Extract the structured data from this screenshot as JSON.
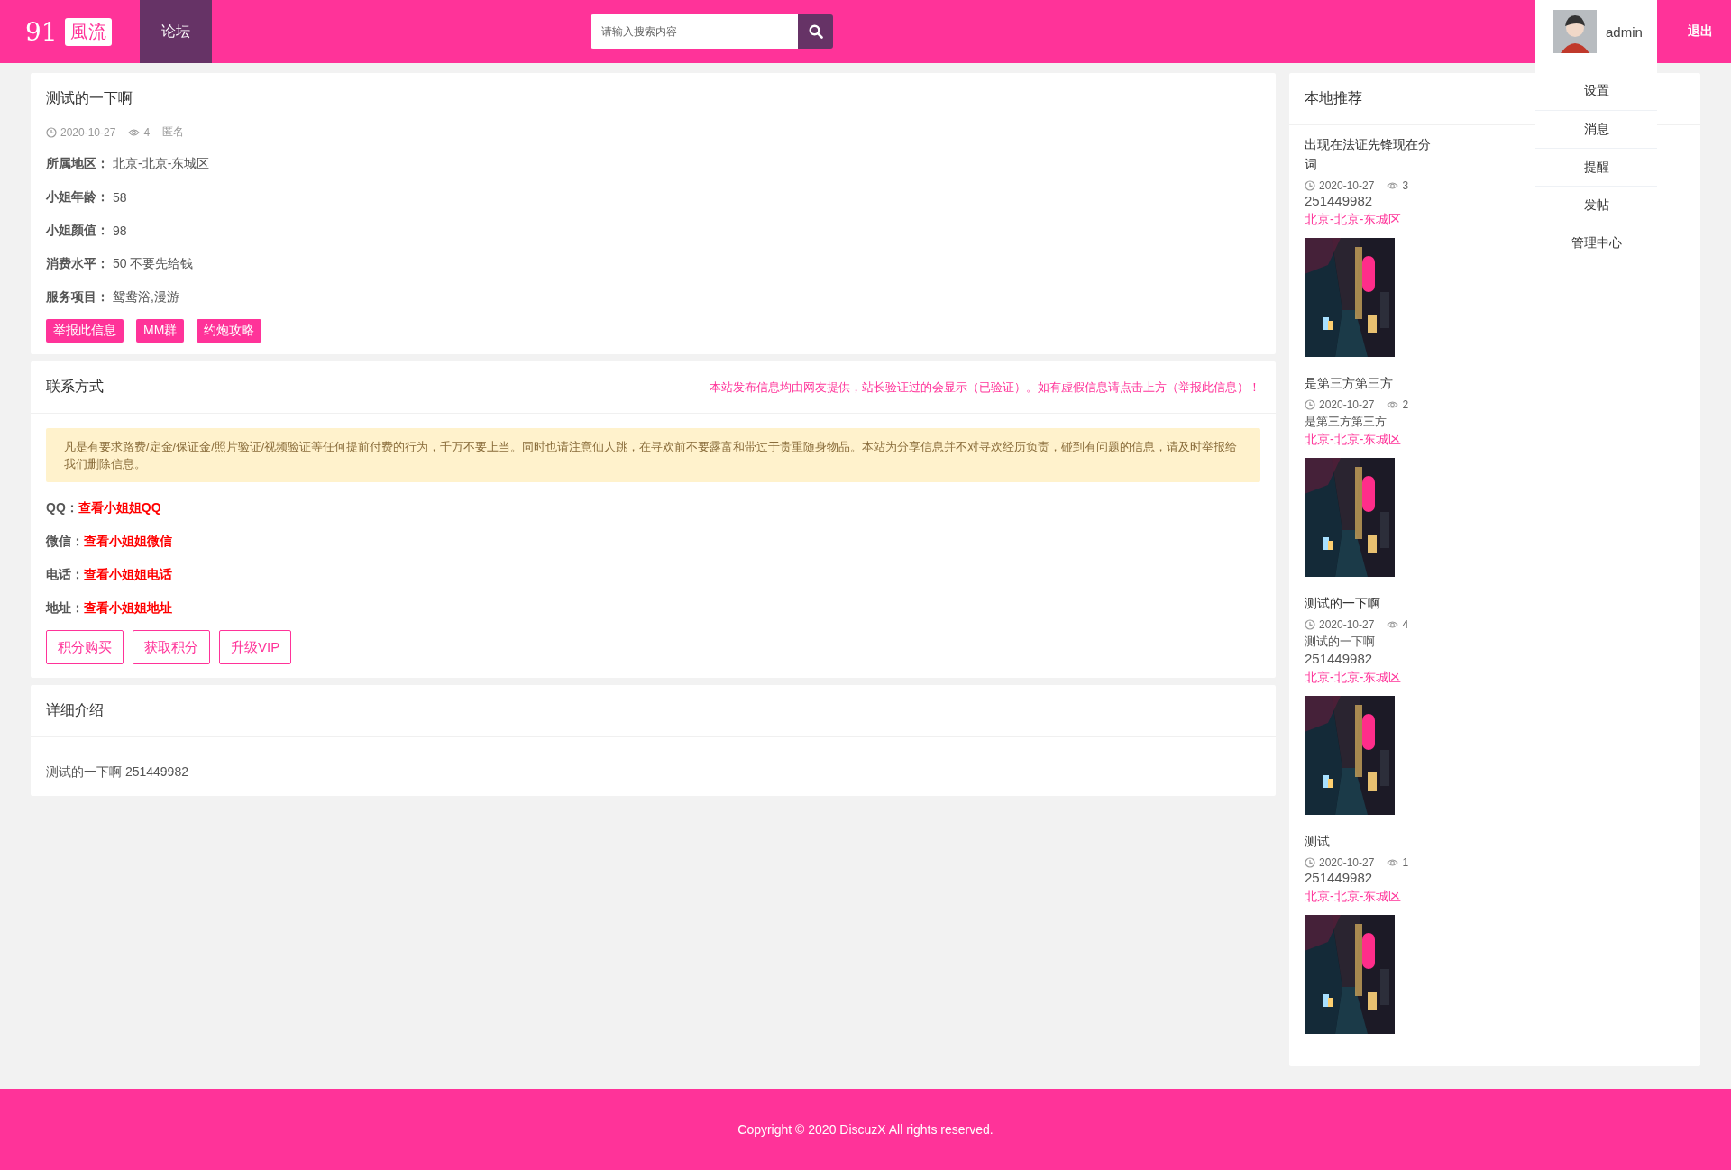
{
  "header": {
    "logo_number": "91",
    "logo_text": "風流",
    "nav": [
      {
        "label": "论坛",
        "selected": true
      }
    ],
    "search": {
      "placeholder": "请输入搜索内容"
    },
    "user": {
      "name": "admin"
    },
    "logout": "退出"
  },
  "user_menu": [
    "设置",
    "消息",
    "提醒",
    "发帖",
    "管理中心"
  ],
  "post": {
    "title": "测试的一下啊",
    "date": "2020-10-27",
    "views": "4",
    "author": "匿名",
    "fields": [
      {
        "label": "所属地区：",
        "value": "北京-北京-东城区"
      },
      {
        "label": "小姐年龄：",
        "value": "58"
      },
      {
        "label": "小姐颜值：",
        "value": "98"
      },
      {
        "label": "消费水平：",
        "value": "50 不要先给钱"
      },
      {
        "label": "服务项目：",
        "value": "鸳鸯浴,漫游"
      }
    ],
    "tags": [
      "举报此信息",
      "MM群",
      "约炮攻略"
    ]
  },
  "contact": {
    "title": "联系方式",
    "notice": "本站发布信息均由网友提供，站长验证过的会显示（已验证）。如有虚假信息请点击上方（举报此信息）！",
    "warning": "凡是有要求路费/定金/保证金/照片验证/视频验证等任何提前付费的行为，千万不要上当。同时也请注意仙人跳，在寻欢前不要露富和带过于贵重随身物品。本站为分享信息并不对寻欢经历负责，碰到有问题的信息，请及时举报给我们删除信息。",
    "items": [
      {
        "label": "QQ：",
        "link": "查看小姐姐QQ"
      },
      {
        "label": "微信：",
        "link": "查看小姐姐微信"
      },
      {
        "label": "电话：",
        "link": "查看小姐姐电话"
      },
      {
        "label": "地址：",
        "link": "查看小姐姐地址"
      }
    ],
    "buttons": [
      "积分购买",
      "获取积分",
      "升级VIP"
    ]
  },
  "detail": {
    "title": "详细介绍",
    "body": "测试的一下啊 251449982"
  },
  "sidebar": {
    "title": "本地推荐",
    "items": [
      {
        "title": "出现在法证先锋现在分词",
        "date": "2020-10-27",
        "views": "3",
        "number": "251449982",
        "location": "北京-北京-东城区"
      },
      {
        "title": "是第三方第三方",
        "date": "2020-10-27",
        "views": "2",
        "desc": "是第三方第三方",
        "location": "北京-北京-东城区"
      },
      {
        "title": "测试的一下啊",
        "date": "2020-10-27",
        "views": "4",
        "desc": "测试的一下啊",
        "number": "251449982",
        "location": "北京-北京-东城区"
      },
      {
        "title": "测试",
        "date": "2020-10-27",
        "views": "1",
        "number": "251449982",
        "location": "北京-北京-东城区"
      }
    ]
  },
  "footer": "Copyright © 2020 DiscuzX All rights reserved."
}
